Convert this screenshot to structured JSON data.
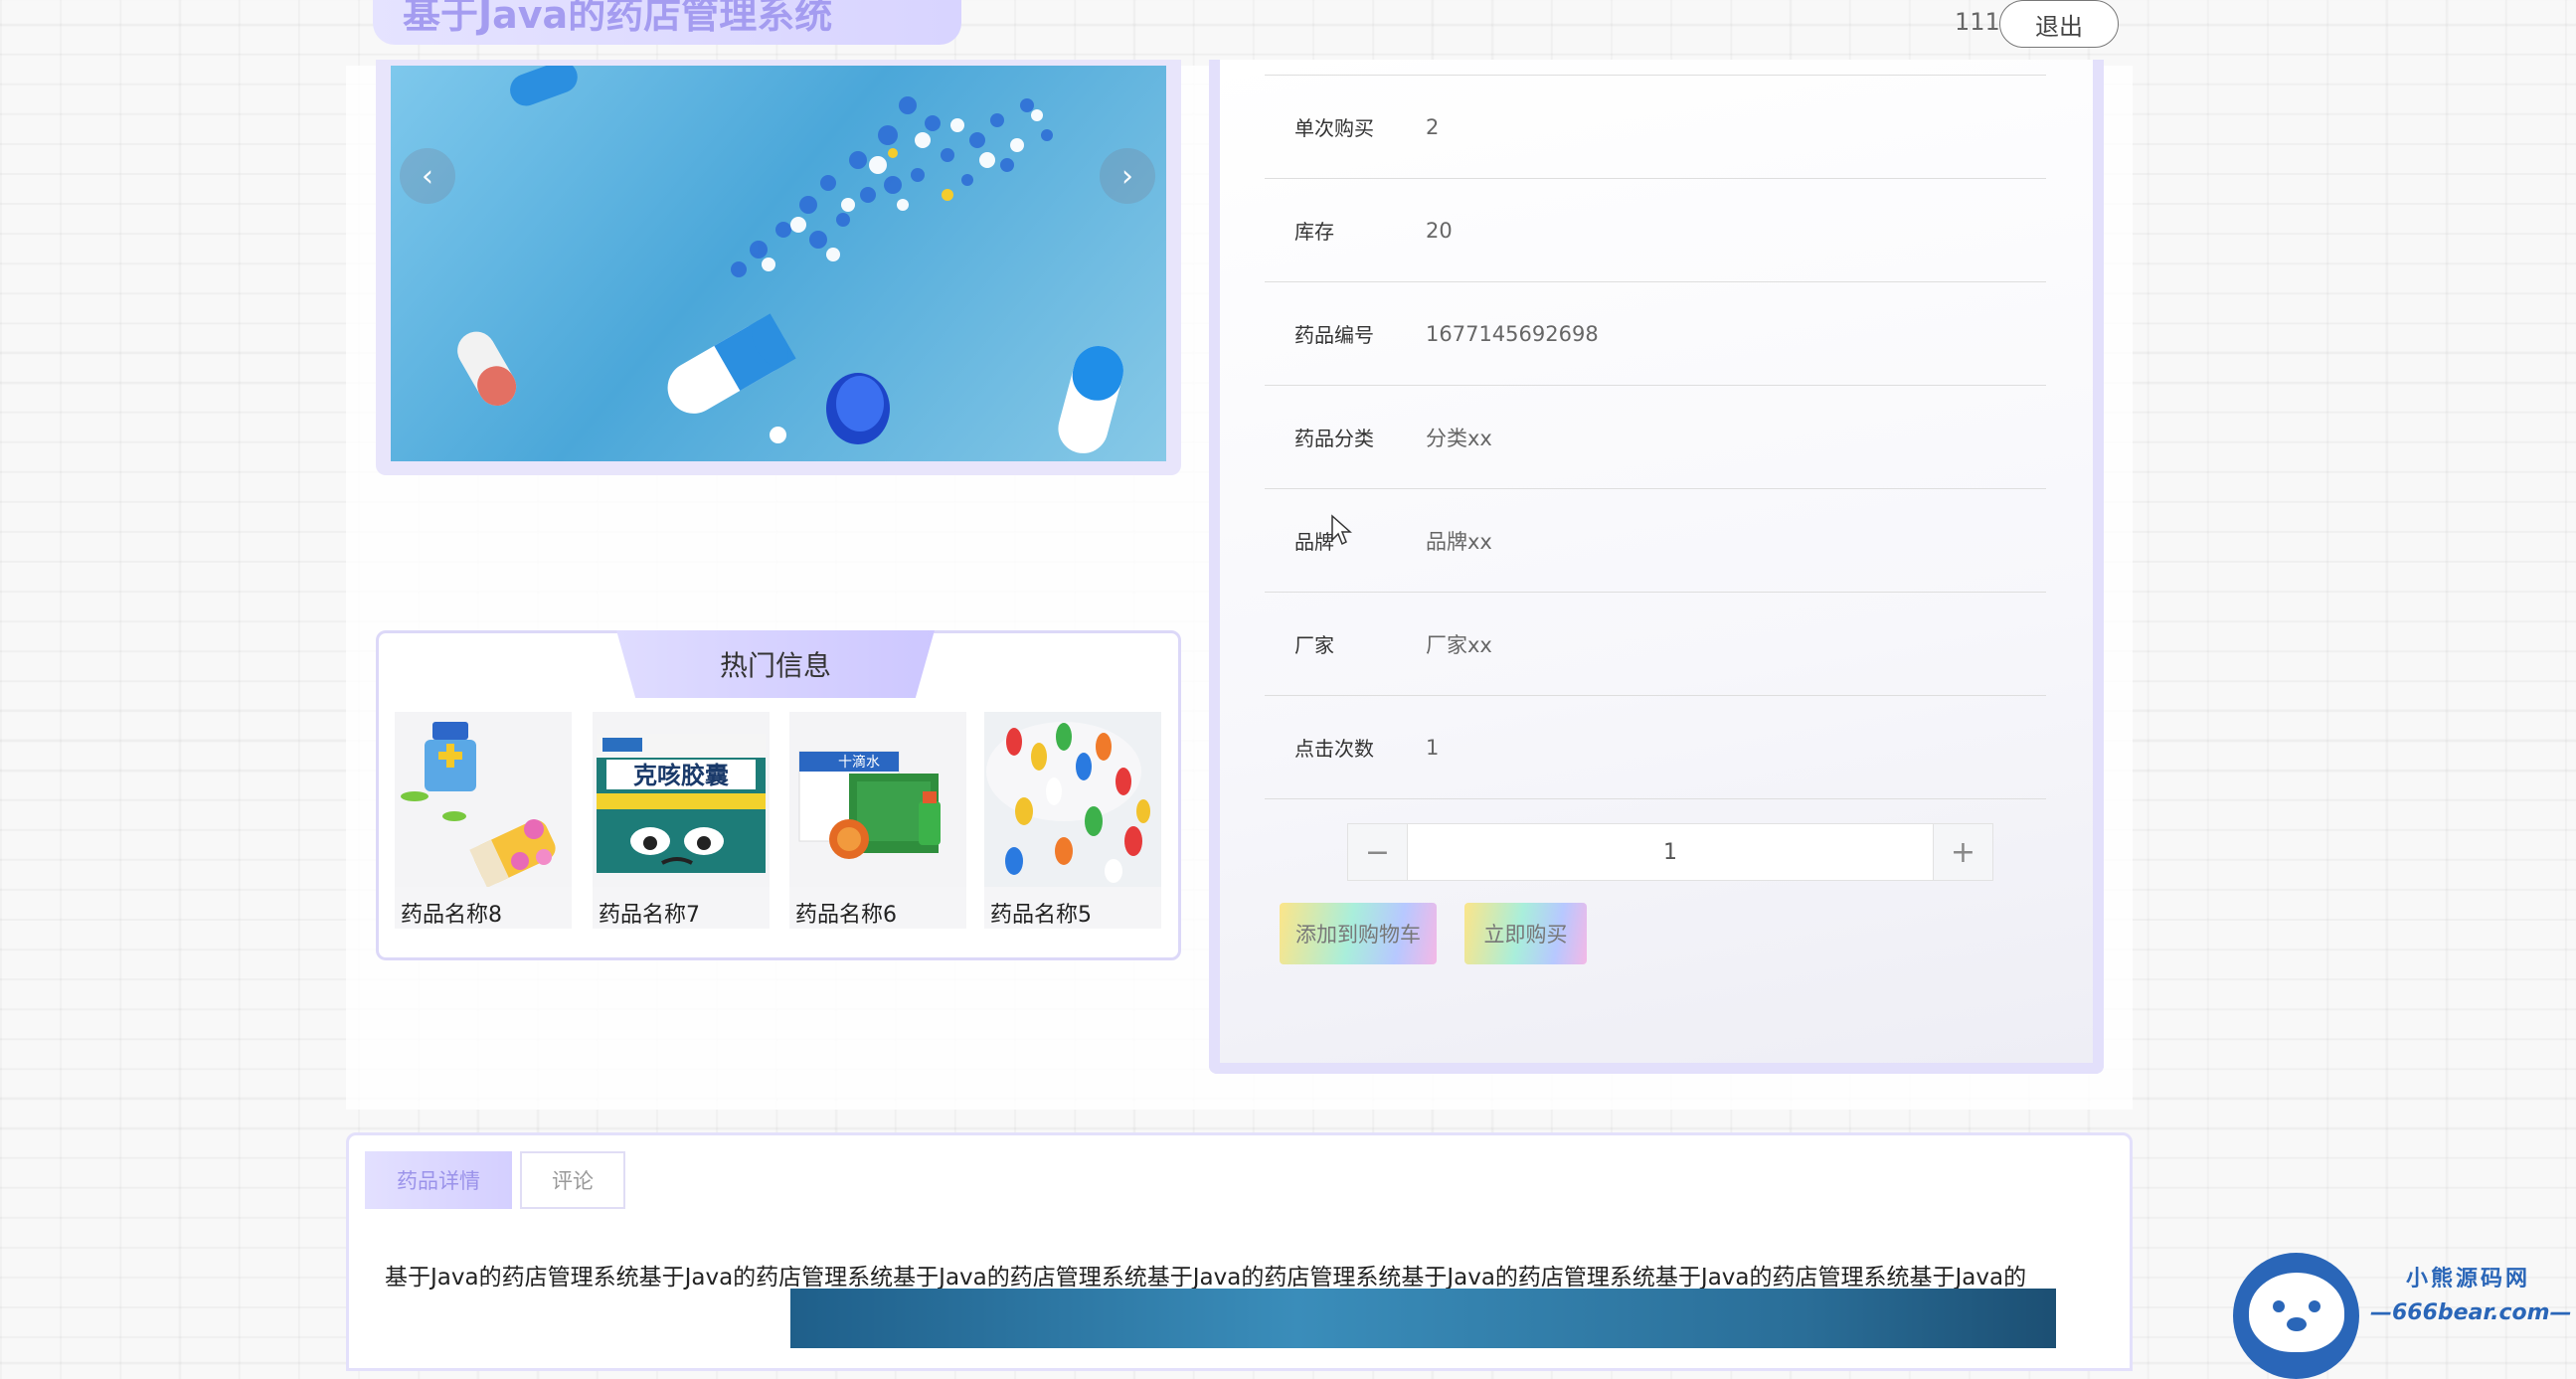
{
  "header": {
    "site_title": "基于Java的药店管理系统",
    "username": "111",
    "logout_label": "退出"
  },
  "carousel": {
    "prev_icon": "chevron-left-icon",
    "next_icon": "chevron-right-icon",
    "slide_count": 1,
    "active_slide": 1
  },
  "hot_info": {
    "title": "热门信息",
    "items": [
      {
        "name": "药品名称8"
      },
      {
        "name": "药品名称7"
      },
      {
        "name": "药品名称6"
      },
      {
        "name": "药品名称5"
      }
    ]
  },
  "detail": {
    "rows": [
      {
        "label": "单次购买",
        "value": "2"
      },
      {
        "label": "库存",
        "value": "20"
      },
      {
        "label": "药品编号",
        "value": "1677145692698"
      },
      {
        "label": "药品分类",
        "value": "分类xx"
      },
      {
        "label": "品牌",
        "value": "品牌xx"
      },
      {
        "label": "厂家",
        "value": "厂家xx"
      },
      {
        "label": "点击次数",
        "value": "1"
      }
    ],
    "quantity": {
      "minus": "−",
      "value": "1",
      "plus": "+"
    },
    "add_to_cart_label": "添加到购物车",
    "buy_now_label": "立即购买"
  },
  "tabs": {
    "items": [
      {
        "label": "药品详情",
        "active": true
      },
      {
        "label": "评论",
        "active": false
      }
    ],
    "description": "基于Java的药店管理系统基于Java的药店管理系统基于Java的药店管理系统基于Java的药店管理系统基于Java的药店管理系统基于Java的药店管理系统基于Java的"
  },
  "watermark": {
    "title": "小熊源码网",
    "subtitle": "—666bear.com—"
  }
}
